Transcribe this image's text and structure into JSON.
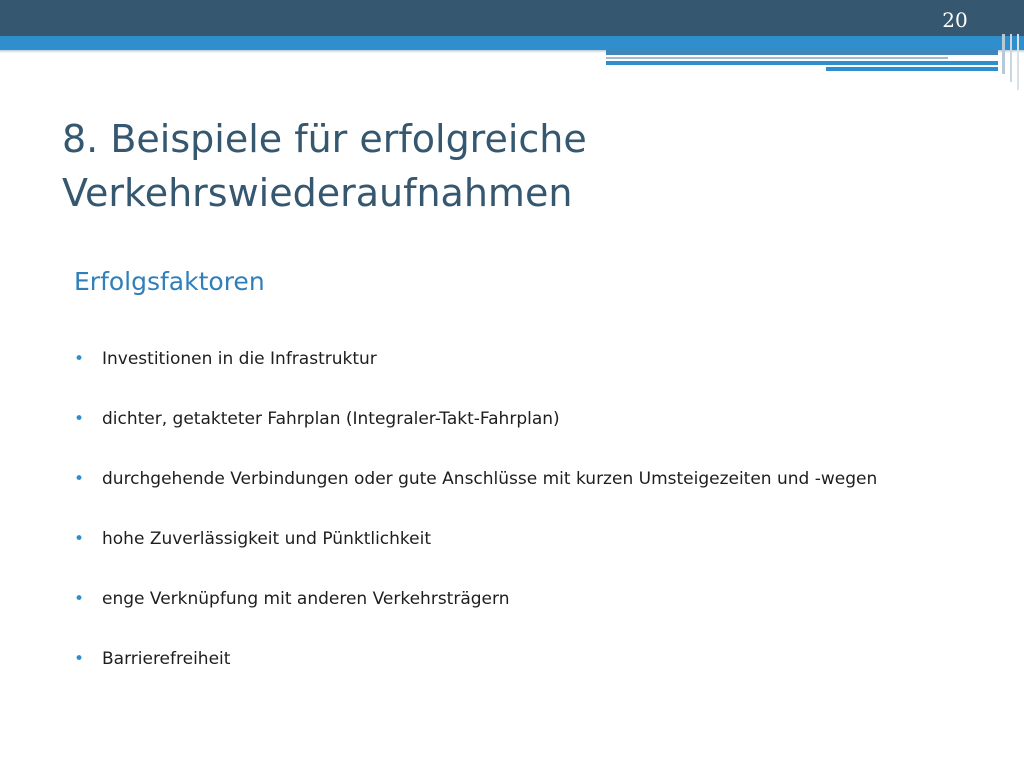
{
  "slide": {
    "number": "20",
    "title": "8. Beispiele für erfolgreiche Verkehrswiederaufnahmen",
    "subtitle": "Erfolgsfaktoren",
    "bullet_glyph": "•",
    "bullets": [
      "Investitionen in die Infrastruktur",
      "dichter, getakteter Fahrplan (Integraler-Takt-Fahrplan)",
      "durchgehende Verbindungen oder gute Anschlüsse mit kurzen Umsteigezeiten und -wegen",
      "hohe Zuverlässigkeit und Pünktlichkeit",
      "enge Verknüpfung mit anderen Verkehrsträgern",
      "Barrierefreiheit"
    ]
  },
  "colors": {
    "header_dark": "#35576f",
    "header_blue": "#2f8fcd",
    "title_text": "#35576f",
    "subtitle_text": "#2f7fba",
    "body_text": "#1e1e1e",
    "bullet": "#2f8fcd"
  }
}
